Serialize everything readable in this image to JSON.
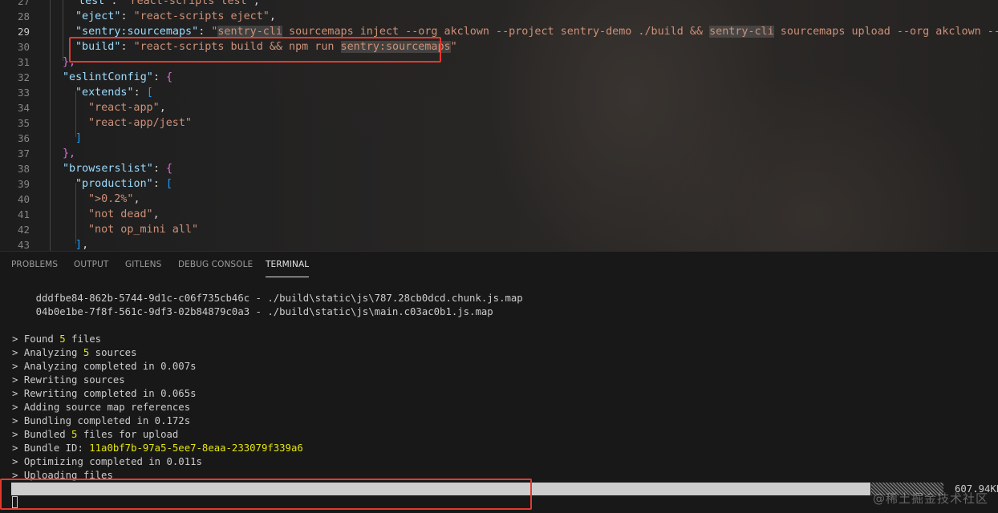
{
  "editor": {
    "lines": [
      {
        "n": "27",
        "indent": 90,
        "parts": [
          {
            "t": "\"test\"",
            "c": "k"
          },
          {
            "t": ": ",
            "c": "p"
          },
          {
            "t": "\"react-scripts test\"",
            "c": "s"
          },
          {
            "t": ",",
            "c": "p"
          }
        ]
      },
      {
        "n": "28",
        "indent": 94,
        "parts": [
          {
            "t": "\"eject\"",
            "c": "k"
          },
          {
            "t": ": ",
            "c": "p"
          },
          {
            "t": "\"react-scripts eject\"",
            "c": "s"
          },
          {
            "t": ",",
            "c": "p"
          }
        ]
      },
      {
        "n": "29",
        "indent": 94,
        "active": true,
        "parts": [
          {
            "t": "\"sentry:sourcemaps\"",
            "c": "k"
          },
          {
            "t": ": ",
            "c": "p"
          },
          {
            "t": "\"",
            "c": "s"
          },
          {
            "t": "sentry-cli",
            "c": "s hlw"
          },
          {
            "t": " sourcemaps inject --org akclown --project sentry-demo ./build && ",
            "c": "s"
          },
          {
            "t": "sentry-cli",
            "c": "s hlw"
          },
          {
            "t": " sourcemaps upload --org akclown --project",
            "c": "s"
          }
        ]
      },
      {
        "n": "30",
        "indent": 94,
        "parts": [
          {
            "t": "\"build\"",
            "c": "k"
          },
          {
            "t": ": ",
            "c": "p"
          },
          {
            "t": "\"react-scripts build && npm run ",
            "c": "s"
          },
          {
            "t": "sentry:sourcemaps",
            "c": "s hlw"
          },
          {
            "t": "\"",
            "c": "s"
          }
        ]
      },
      {
        "n": "31",
        "indent": 78,
        "parts": [
          {
            "t": "},",
            "c": "b1"
          }
        ]
      },
      {
        "n": "32",
        "indent": 78,
        "parts": [
          {
            "t": "\"eslintConfig\"",
            "c": "k"
          },
          {
            "t": ": ",
            "c": "p"
          },
          {
            "t": "{",
            "c": "b1"
          }
        ]
      },
      {
        "n": "33",
        "indent": 94,
        "parts": [
          {
            "t": "\"extends\"",
            "c": "k"
          },
          {
            "t": ": ",
            "c": "p"
          },
          {
            "t": "[",
            "c": "b2"
          }
        ]
      },
      {
        "n": "34",
        "indent": 110,
        "parts": [
          {
            "t": "\"react-app\"",
            "c": "s"
          },
          {
            "t": ",",
            "c": "p"
          }
        ]
      },
      {
        "n": "35",
        "indent": 110,
        "parts": [
          {
            "t": "\"react-app/jest\"",
            "c": "s"
          }
        ]
      },
      {
        "n": "36",
        "indent": 94,
        "parts": [
          {
            "t": "]",
            "c": "b2"
          }
        ]
      },
      {
        "n": "37",
        "indent": 78,
        "parts": [
          {
            "t": "},",
            "c": "b1"
          }
        ]
      },
      {
        "n": "38",
        "indent": 78,
        "parts": [
          {
            "t": "\"browserslist\"",
            "c": "k"
          },
          {
            "t": ": ",
            "c": "p"
          },
          {
            "t": "{",
            "c": "b1"
          }
        ]
      },
      {
        "n": "39",
        "indent": 94,
        "parts": [
          {
            "t": "\"production\"",
            "c": "k"
          },
          {
            "t": ": ",
            "c": "p"
          },
          {
            "t": "[",
            "c": "b2"
          }
        ]
      },
      {
        "n": "40",
        "indent": 110,
        "parts": [
          {
            "t": "\">0.2%\"",
            "c": "s"
          },
          {
            "t": ",",
            "c": "p"
          }
        ]
      },
      {
        "n": "41",
        "indent": 110,
        "parts": [
          {
            "t": "\"not dead\"",
            "c": "s"
          },
          {
            "t": ",",
            "c": "p"
          }
        ]
      },
      {
        "n": "42",
        "indent": 110,
        "parts": [
          {
            "t": "\"not op_mini all\"",
            "c": "s"
          }
        ]
      },
      {
        "n": "43",
        "indent": 94,
        "parts": [
          {
            "t": "]",
            "c": "b2"
          },
          {
            "t": ",",
            "c": "p"
          }
        ]
      }
    ]
  },
  "panel": {
    "tabs": [
      {
        "label": "PROBLEMS",
        "active": false
      },
      {
        "label": "OUTPUT",
        "active": false
      },
      {
        "label": "GITLENS",
        "active": false
      },
      {
        "label": "DEBUG CONSOLE",
        "active": false
      },
      {
        "label": "TERMINAL",
        "active": true
      }
    ]
  },
  "terminal": {
    "map_lines": [
      "    dddfbe84-862b-5744-9d1c-c06f735cb46c - ./build\\static\\js\\787.28cb0dcd.chunk.js.map",
      "    04b0e1be-7f8f-561c-9df3-02b84879c0a3 - ./build\\static\\js\\main.c03ac0b1.js.map"
    ],
    "steps": [
      {
        "pre": "Found ",
        "num": "5",
        "post": " files"
      },
      {
        "pre": "Analyzing ",
        "num": "5",
        "post": " sources"
      },
      {
        "pre": "Analyzing completed in 0.007s",
        "num": "",
        "post": ""
      },
      {
        "pre": "Rewriting sources",
        "num": "",
        "post": ""
      },
      {
        "pre": "Rewriting completed in 0.065s",
        "num": "",
        "post": ""
      },
      {
        "pre": "Adding source map references",
        "num": "",
        "post": ""
      },
      {
        "pre": "Bundling completed in 0.172s",
        "num": "",
        "post": ""
      },
      {
        "pre": "Bundled ",
        "num": "5",
        "post": " files for upload"
      },
      {
        "pre": "Bundle ID: ",
        "num": "11a0bf7b-97a5-5ee7-8eaa-233079f339a6",
        "post": ""
      },
      {
        "pre": "Optimizing completed in 0.011s",
        "num": "",
        "post": ""
      },
      {
        "pre": "Uploading files",
        "num": "",
        "post": ""
      }
    ],
    "prompt_glyph": ">",
    "upload_size": "607.94KB",
    "upload_progress": 0.92
  },
  "watermark": "@稀土掘金技术社区",
  "colors": {
    "highlight_box": "#e33a2e",
    "accent_yellow": "#e5e510"
  }
}
